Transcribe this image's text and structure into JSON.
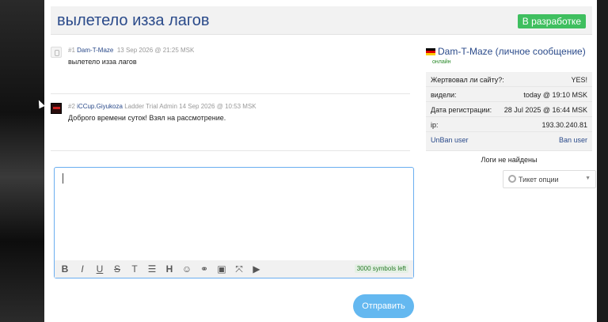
{
  "ticket": {
    "title": "вылетело изза лагов",
    "status": "В разработке"
  },
  "messages": [
    {
      "num": "#1",
      "user": "Dam-T-Maze",
      "role": "",
      "date": "13 Sep 2026 @ 21:25 MSK",
      "text": "вылетело изза лагов"
    },
    {
      "num": "#2",
      "user": "iCCup.Giyukoza",
      "role": "Ladder Trial Admin",
      "date": "14 Sep 2026 @ 10:53 MSK",
      "text": "Доброго времени суток! Взял на рассмотрение."
    }
  ],
  "editor": {
    "counter": "3000 symbols left",
    "send_label": "Отправить"
  },
  "toolbar_icons": [
    "bold-icon",
    "italic-icon",
    "underline-icon",
    "strikethrough-icon",
    "clear-format-icon",
    "list-icon",
    "heading-icon",
    "emoji-icon",
    "link-icon",
    "image-icon",
    "spoiler-icon",
    "youtube-icon"
  ],
  "sidebar": {
    "user": "Dam-T-Maze (личное сообщение)",
    "online": "онлайн",
    "rows": [
      {
        "k": "Жертвовал ли сайту?:",
        "v": "YES!"
      },
      {
        "k": "видели:",
        "v": "today @ 19:10 MSK"
      },
      {
        "k": "Дата регистрации:",
        "v": "28 Jul 2025 @ 16:44 MSK"
      },
      {
        "k": "ip:",
        "v": "193.30.240.81"
      }
    ],
    "unban": "UnBan user",
    "ban": "Ban user",
    "nologs": "Логи не найдены",
    "options": "Тикет опции"
  },
  "colors": {
    "link": "#2a4a8a",
    "status": "#3fbf5f",
    "send": "#64b8f0"
  }
}
